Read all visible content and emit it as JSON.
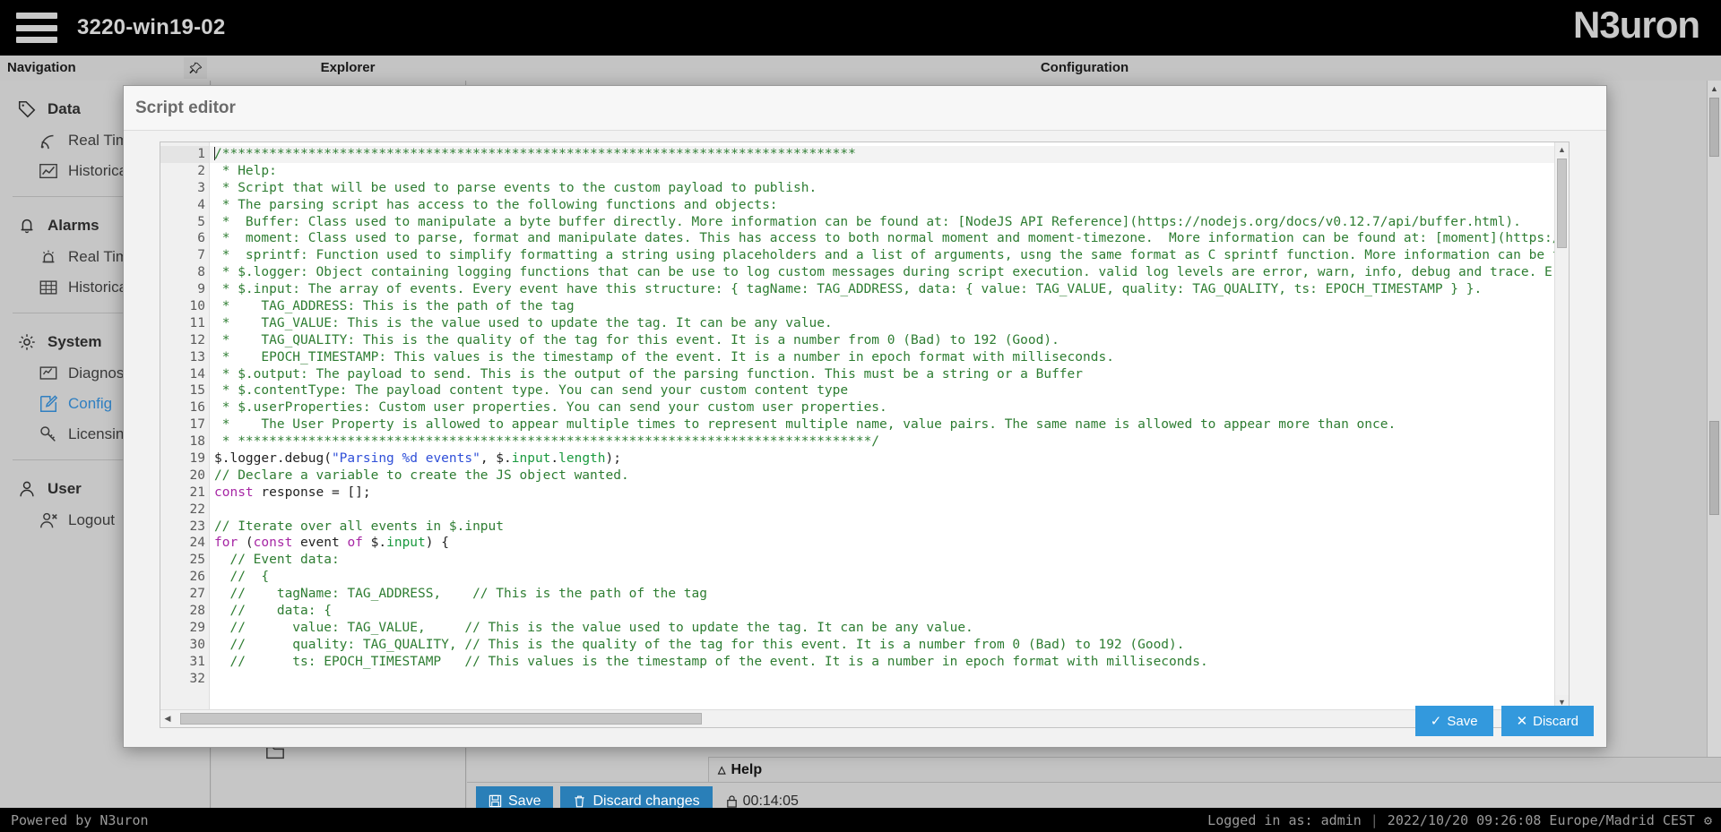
{
  "topbar": {
    "menu_icon": "hamburger-icon",
    "host": "3220-win19-02",
    "brand": "N3uron"
  },
  "columns": {
    "navigation": "Navigation",
    "explorer": "Explorer",
    "configuration": "Configuration",
    "pin_icon": "pin-icon"
  },
  "sidebar": {
    "groups": [
      {
        "title": "Data",
        "icon": "tag-icon",
        "items": [
          {
            "label": "Real Time",
            "icon": "signal-icon",
            "active": false
          },
          {
            "label": "Historical",
            "icon": "chart-line-icon",
            "active": false
          }
        ]
      },
      {
        "title": "Alarms",
        "icon": "bell-icon",
        "items": [
          {
            "label": "Real Time",
            "icon": "siren-icon",
            "active": false
          },
          {
            "label": "Historical",
            "icon": "table-icon",
            "active": false
          }
        ]
      },
      {
        "title": "System",
        "icon": "gear-icon",
        "items": [
          {
            "label": "Diagnostics",
            "icon": "monitor-icon",
            "active": false
          },
          {
            "label": "Config",
            "icon": "pencil-square-icon",
            "active": true
          },
          {
            "label": "Licensing",
            "icon": "key-icon",
            "active": false
          }
        ]
      },
      {
        "title": "User",
        "icon": "user-icon",
        "items": [
          {
            "label": "Logout",
            "icon": "user-logout-icon",
            "active": false
          }
        ]
      }
    ]
  },
  "modal": {
    "title": "Script editor",
    "save_label": "Save",
    "save_icon": "check-icon",
    "discard_label": "Discard",
    "discard_icon": "cross-icon",
    "current_line": 1,
    "lines": [
      {
        "n": 1,
        "fold": true,
        "segments": [
          {
            "t": "caret",
            "v": ""
          },
          {
            "t": "cm",
            "v": "/*********************************************************************************"
          }
        ]
      },
      {
        "n": 2,
        "fold": false,
        "segments": [
          {
            "t": "cm",
            "v": " * Help:"
          }
        ]
      },
      {
        "n": 3,
        "fold": false,
        "segments": [
          {
            "t": "cm",
            "v": " * Script that will be used to parse events to the custom payload to publish."
          }
        ]
      },
      {
        "n": 4,
        "fold": false,
        "segments": [
          {
            "t": "cm",
            "v": " * The parsing script has access to the following functions and objects:"
          }
        ]
      },
      {
        "n": 5,
        "fold": false,
        "segments": [
          {
            "t": "cm",
            "v": " *  Buffer: Class used to manipulate a byte buffer directly. More information can be found at: [NodeJS API Reference](https://nodejs.org/docs/v0.12.7/api/buffer.html)."
          }
        ]
      },
      {
        "n": 6,
        "fold": false,
        "segments": [
          {
            "t": "cm",
            "v": " *  moment: Class used to parse, format and manipulate dates. This has access to both normal moment and moment-timezone.  More information can be found at: [moment](https:/"
          }
        ]
      },
      {
        "n": 7,
        "fold": false,
        "segments": [
          {
            "t": "cm",
            "v": " *  sprintf: Function used to simplify formatting a string using placeholders and a list of arguments, usng the same format as C sprintf function. More information can be f"
          }
        ]
      },
      {
        "n": 8,
        "fold": false,
        "segments": [
          {
            "t": "cm",
            "v": " * $.logger: Object containing logging functions that can be use to log custom messages during script execution. valid log levels are error, warn, info, debug and trace. E"
          }
        ]
      },
      {
        "n": 9,
        "fold": false,
        "segments": [
          {
            "t": "cm",
            "v": " * $.input: The array of events. Every event have this structure: { tagName: TAG_ADDRESS, data: { value: TAG_VALUE, quality: TAG_QUALITY, ts: EPOCH_TIMESTAMP } }."
          }
        ]
      },
      {
        "n": 10,
        "fold": false,
        "segments": [
          {
            "t": "cm",
            "v": " *    TAG_ADDRESS: This is the path of the tag"
          }
        ]
      },
      {
        "n": 11,
        "fold": false,
        "segments": [
          {
            "t": "cm",
            "v": " *    TAG_VALUE: This is the value used to update the tag. It can be any value."
          }
        ]
      },
      {
        "n": 12,
        "fold": false,
        "segments": [
          {
            "t": "cm",
            "v": " *    TAG_QUALITY: This is the quality of the tag for this event. It is a number from 0 (Bad) to 192 (Good)."
          }
        ]
      },
      {
        "n": 13,
        "fold": false,
        "segments": [
          {
            "t": "cm",
            "v": " *    EPOCH_TIMESTAMP: This values is the timestamp of the event. It is a number in epoch format with milliseconds."
          }
        ]
      },
      {
        "n": 14,
        "fold": false,
        "segments": [
          {
            "t": "cm",
            "v": " * $.output: The payload to send. This is the output of the parsing function. This must be a string or a Buffer"
          }
        ]
      },
      {
        "n": 15,
        "fold": false,
        "segments": [
          {
            "t": "cm",
            "v": " * $.contentType: The payload content type. You can send your custom content type"
          }
        ]
      },
      {
        "n": 16,
        "fold": false,
        "segments": [
          {
            "t": "cm",
            "v": " * $.userProperties: Custom user properties. You can send your custom user properties."
          }
        ]
      },
      {
        "n": 17,
        "fold": false,
        "segments": [
          {
            "t": "cm",
            "v": " *    The User Property is allowed to appear multiple times to represent multiple name, value pairs. The same name is allowed to appear more than once."
          }
        ]
      },
      {
        "n": 18,
        "fold": false,
        "segments": [
          {
            "t": "cm",
            "v": " * *********************************************************************************/"
          }
        ]
      },
      {
        "n": 19,
        "fold": false,
        "segments": [
          {
            "t": "pl",
            "v": "$.logger.debug("
          },
          {
            "t": "st",
            "v": "\"Parsing %d events\""
          },
          {
            "t": "pl",
            "v": ", $."
          },
          {
            "t": "pr",
            "v": "input"
          },
          {
            "t": "pl",
            "v": "."
          },
          {
            "t": "pr",
            "v": "length"
          },
          {
            "t": "pl",
            "v": ");"
          }
        ]
      },
      {
        "n": 20,
        "fold": false,
        "segments": [
          {
            "t": "cm",
            "v": "// Declare a variable to create the JS object wanted."
          }
        ]
      },
      {
        "n": 21,
        "fold": false,
        "segments": [
          {
            "t": "kw",
            "v": "const"
          },
          {
            "t": "pl",
            "v": " response = [];"
          }
        ]
      },
      {
        "n": 22,
        "fold": false,
        "segments": [
          {
            "t": "pl",
            "v": ""
          }
        ]
      },
      {
        "n": 23,
        "fold": false,
        "segments": [
          {
            "t": "cm",
            "v": "// Iterate over all events in $.input"
          }
        ]
      },
      {
        "n": 24,
        "fold": true,
        "segments": [
          {
            "t": "kw",
            "v": "for"
          },
          {
            "t": "pl",
            "v": " ("
          },
          {
            "t": "kw",
            "v": "const"
          },
          {
            "t": "pl",
            "v": " event "
          },
          {
            "t": "kw",
            "v": "of"
          },
          {
            "t": "pl",
            "v": " $."
          },
          {
            "t": "pr",
            "v": "input"
          },
          {
            "t": "pl",
            "v": ") {"
          }
        ]
      },
      {
        "n": 25,
        "fold": false,
        "segments": [
          {
            "t": "cm",
            "v": "  // Event data:"
          }
        ]
      },
      {
        "n": 26,
        "fold": true,
        "segments": [
          {
            "t": "cm",
            "v": "  //  {"
          }
        ]
      },
      {
        "n": 27,
        "fold": false,
        "segments": [
          {
            "t": "cm",
            "v": "  //    tagName: TAG_ADDRESS,    // This is the path of the tag"
          }
        ]
      },
      {
        "n": 28,
        "fold": true,
        "segments": [
          {
            "t": "cm",
            "v": "  //    data: {"
          }
        ]
      },
      {
        "n": 29,
        "fold": false,
        "segments": [
          {
            "t": "cm",
            "v": "  //      value: TAG_VALUE,     // This is the value used to update the tag. It can be any value."
          }
        ]
      },
      {
        "n": 30,
        "fold": false,
        "segments": [
          {
            "t": "cm",
            "v": "  //      quality: TAG_QUALITY, // This is the quality of the tag for this event. It is a number from 0 (Bad) to 192 (Good)."
          }
        ]
      },
      {
        "n": 31,
        "fold": false,
        "segments": [
          {
            "t": "cm",
            "v": "  //      ts: EPOCH_TIMESTAMP   // This values is the timestamp of the event. It is a number in epoch format with milliseconds."
          }
        ]
      },
      {
        "n": 32,
        "fold": false,
        "segments": [
          {
            "t": "pl",
            "v": ""
          }
        ]
      }
    ]
  },
  "config_bar": {
    "help_label": "Help",
    "help_caret_icon": "caret-up-icon",
    "save_label": "Save",
    "save_icon": "floppy-icon",
    "discard_label": "Discard changes",
    "discard_icon": "trash-icon",
    "lock_icon": "lock-icon",
    "timer": "00:14:05"
  },
  "statusbar": {
    "powered": "Powered by N3uron",
    "logged_in": "Logged in as: admin",
    "datetime": "2022/10/20 09:26:08 Europe/Madrid CEST",
    "settings_icon": "gear-icon"
  },
  "colors": {
    "accent": "#3399dd",
    "accent_dark": "#2a7fb8",
    "comment": "#2e7d32",
    "keyword": "#a626a4",
    "string": "#2f4fd8",
    "property": "#1a9a3f"
  }
}
